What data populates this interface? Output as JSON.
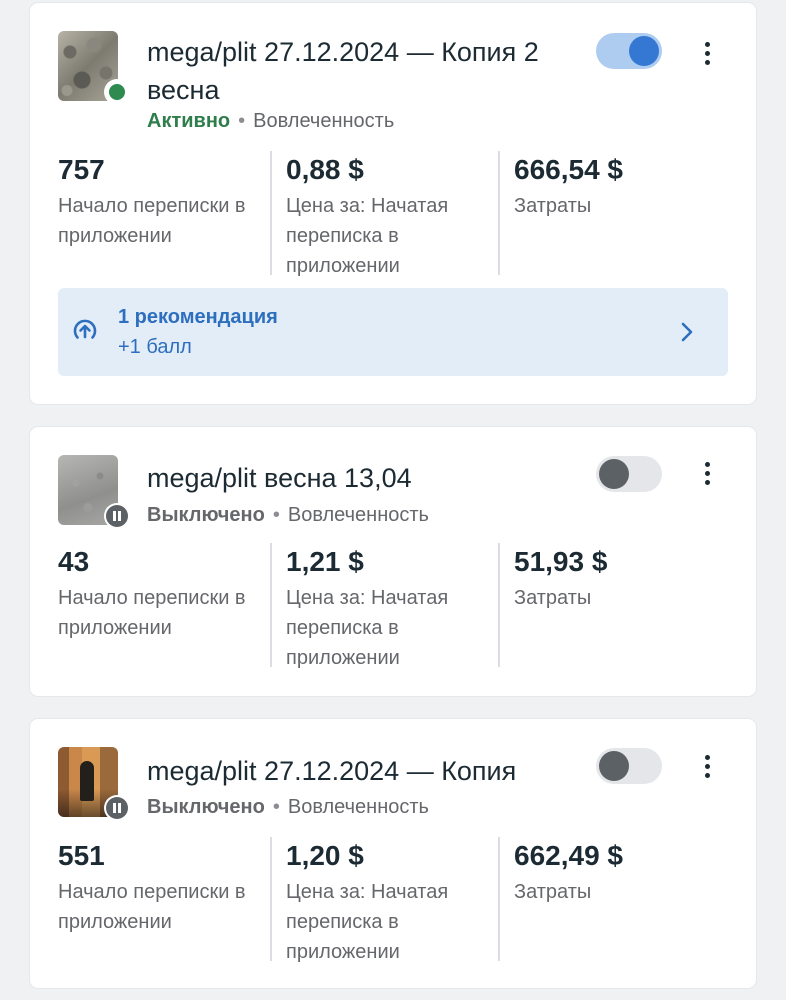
{
  "colors": {
    "active_status": "#2e7d4b",
    "active_dot": "#2e8a4f",
    "toggle_on": "#3578d4",
    "toggle_off_knob": "#5c6166",
    "recommendation_bg": "#e3edf8",
    "recommendation_text": "#2d6fbe"
  },
  "campaigns": [
    {
      "title": "mega/plit 27.12.2024 — Копия 2 весна",
      "status": "Активно",
      "separator": "•",
      "objective": "Вовлеченность",
      "toggle_on": true,
      "thumbnail_icon": "stones-thumbnail",
      "status_icon": "active-dot-icon",
      "metrics": [
        {
          "value": "757",
          "label": "Начало переписки в приложении"
        },
        {
          "value": "0,88 $",
          "label": "Цена за: Начатая переписка в приложении"
        },
        {
          "value": "666,54 $",
          "label": "Затраты"
        }
      ],
      "recommendation": {
        "title": "1 рекомендация",
        "subtitle": "+1 балл",
        "icon": "arrow-up-circle-icon",
        "chevron": "chevron-right-icon"
      }
    },
    {
      "title": "mega/plit весна 13,04",
      "status": "Выключено",
      "separator": "•",
      "objective": "Вовлеченность",
      "toggle_on": false,
      "thumbnail_icon": "gravel-thumbnail",
      "status_icon": "pause-icon",
      "metrics": [
        {
          "value": "43",
          "label": "Начало переписки в приложении"
        },
        {
          "value": "1,21 $",
          "label": "Цена за: Начатая переписка в приложении"
        },
        {
          "value": "51,93 $",
          "label": "Затраты"
        }
      ]
    },
    {
      "title": "mega/plit 27.12.2024 — Копия",
      "status": "Выключено",
      "separator": "•",
      "objective": "Вовлеченность",
      "toggle_on": false,
      "thumbnail_icon": "person-thumbnail",
      "status_icon": "pause-icon",
      "metrics": [
        {
          "value": "551",
          "label": "Начало переписки в приложении"
        },
        {
          "value": "1,20 $",
          "label": "Цена за: Начатая переписка в приложении"
        },
        {
          "value": "662,49 $",
          "label": "Затраты"
        }
      ]
    }
  ]
}
